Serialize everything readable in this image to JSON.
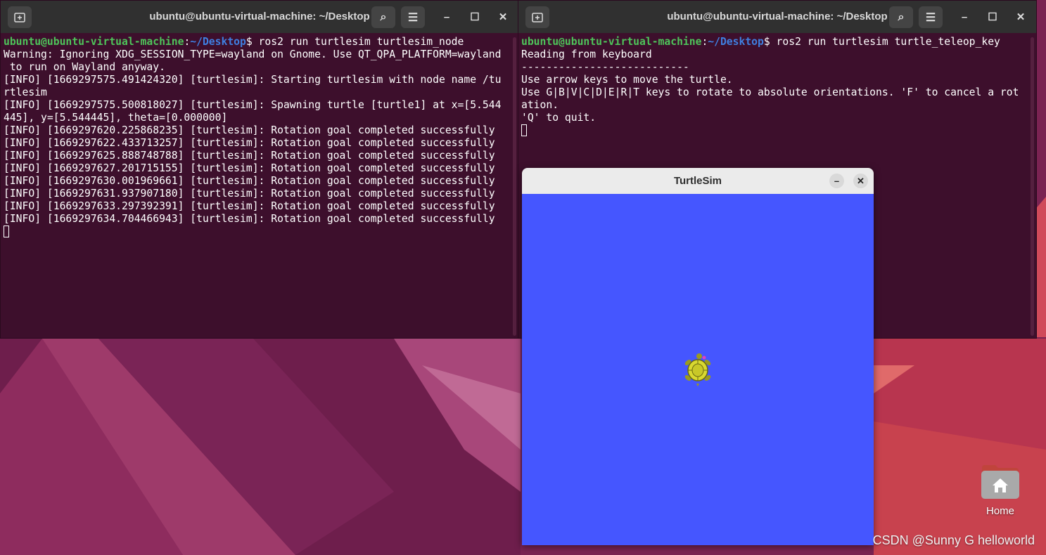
{
  "terminal_left": {
    "title": "ubuntu@ubuntu-virtual-machine: ~/Desktop",
    "prompt_user": "ubuntu@ubuntu-virtual-machine",
    "prompt_sep": ":",
    "prompt_path": "~/Desktop",
    "prompt_dollar": "$",
    "command": " ros2 run turtlesim turtlesim_node",
    "lines": [
      "Warning: Ignoring XDG_SESSION_TYPE=wayland on Gnome. Use QT_QPA_PLATFORM=wayland",
      " to run on Wayland anyway.",
      "[INFO] [1669297575.491424320] [turtlesim]: Starting turtlesim with node name /tu",
      "rtlesim",
      "[INFO] [1669297575.500818027] [turtlesim]: Spawning turtle [turtle1] at x=[5.544",
      "445], y=[5.544445], theta=[0.000000]",
      "[INFO] [1669297620.225868235] [turtlesim]: Rotation goal completed successfully",
      "[INFO] [1669297622.433713257] [turtlesim]: Rotation goal completed successfully",
      "[INFO] [1669297625.888748788] [turtlesim]: Rotation goal completed successfully",
      "[INFO] [1669297627.201715155] [turtlesim]: Rotation goal completed successfully",
      "[INFO] [1669297630.001969661] [turtlesim]: Rotation goal completed successfully",
      "[INFO] [1669297631.937907180] [turtlesim]: Rotation goal completed successfully",
      "[INFO] [1669297633.297392391] [turtlesim]: Rotation goal completed successfully",
      "[INFO] [1669297634.704466943] [turtlesim]: Rotation goal completed successfully"
    ]
  },
  "terminal_right": {
    "title": "ubuntu@ubuntu-virtual-machine: ~/Desktop",
    "prompt_user": "ubuntu@ubuntu-virtual-machine",
    "prompt_sep": ":",
    "prompt_path": "~/Desktop",
    "prompt_dollar": "$",
    "command": " ros2 run turtlesim turtle_teleop_key",
    "lines": [
      "Reading from keyboard",
      "---------------------------",
      "Use arrow keys to move the turtle.",
      "Use G|B|V|C|D|E|R|T keys to rotate to absolute orientations. 'F' to cancel a rot",
      "ation.",
      "'Q' to quit."
    ]
  },
  "turtlesim": {
    "title": "TurtleSim",
    "minimize_glyph": "–",
    "close_glyph": "✕",
    "background_color": "#4556ff"
  },
  "icons": {
    "new_tab": "new-tab-icon",
    "search": "search-icon",
    "menu": "hamburger-menu-icon",
    "minimize": "minimize-icon",
    "maximize": "maximize-icon",
    "close": "close-icon",
    "turtle": "turtle-icon",
    "home_folder": "home-folder-icon"
  },
  "window_glyphs": {
    "search": "⌕",
    "menu": "☰",
    "minimize": "–",
    "maximize": "☐",
    "close": "✕"
  },
  "desktop": {
    "home_label": "Home",
    "watermark": "CSDN @Sunny G helloworld"
  }
}
